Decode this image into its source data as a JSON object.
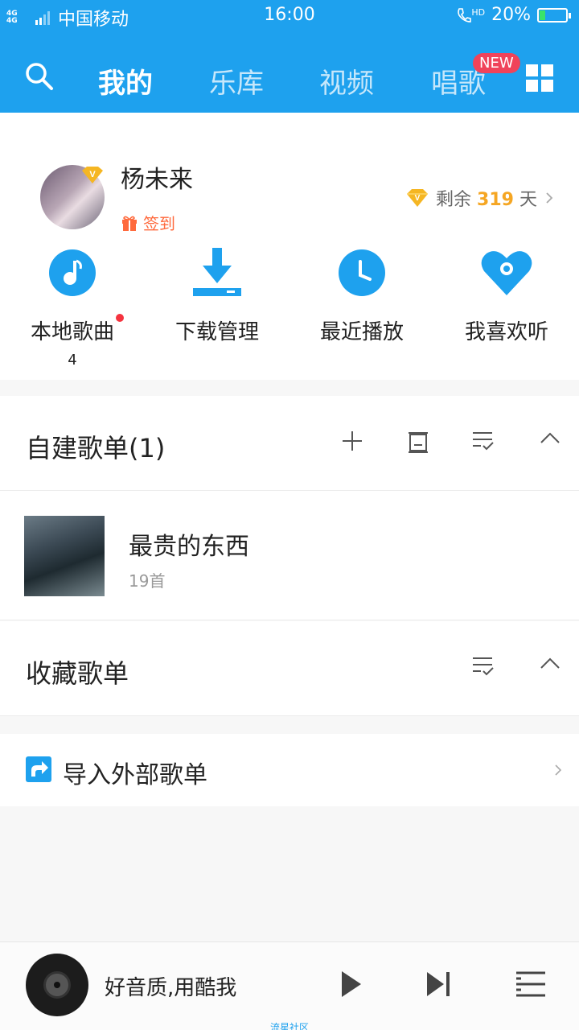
{
  "status_bar": {
    "network": "4G 4G",
    "carrier": "中国移动",
    "time": "16:00",
    "call_label": "HD",
    "battery": "20%"
  },
  "nav": {
    "tabs": [
      {
        "label": "我的"
      },
      {
        "label": "乐库"
      },
      {
        "label": "视频"
      },
      {
        "label": "唱歌"
      }
    ],
    "badge": "NEW"
  },
  "profile": {
    "username": "杨未来",
    "signin_label": "签到",
    "vip_prefix": "剩余",
    "vip_days": "319",
    "vip_suffix": "天"
  },
  "quick_actions": [
    {
      "label": "本地歌曲",
      "count": "4"
    },
    {
      "label": "下载管理"
    },
    {
      "label": "最近播放"
    },
    {
      "label": "我喜欢听"
    }
  ],
  "my_playlists": {
    "title": "自建歌单(1)",
    "items": [
      {
        "name": "最贵的东西",
        "count": "19首"
      }
    ]
  },
  "collected_playlists": {
    "title": "收藏歌单"
  },
  "import": {
    "label": "导入外部歌单"
  },
  "player": {
    "song": "好音质,用酷我"
  },
  "watermark": "流星社区",
  "colors": {
    "brand": "#1ea1ee",
    "vip_gold": "#f5a623",
    "signin": "#ff6a3d",
    "badge_red": "#f0435a"
  }
}
